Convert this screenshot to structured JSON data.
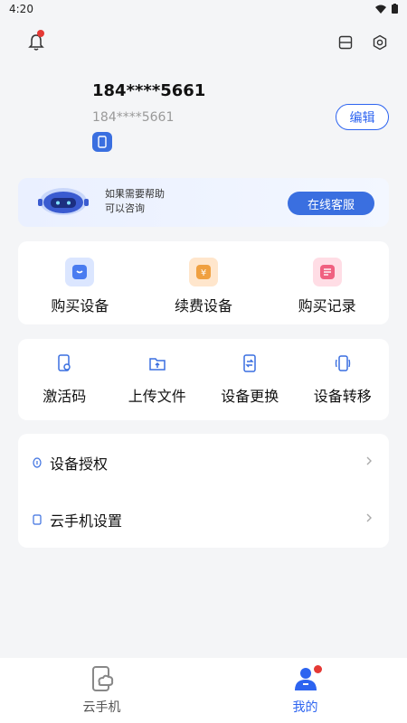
{
  "status": {
    "time": "4:20"
  },
  "header": {
    "bell_badge": "1"
  },
  "profile": {
    "username": "184****5661",
    "subname": "184****5661",
    "edit_label": "编辑"
  },
  "banner": {
    "line1": "如果需要帮助",
    "line2": "可以咨询",
    "button_label": "在线客服"
  },
  "card1": {
    "items": [
      {
        "label": "购买设备",
        "icon": "buy-device-icon",
        "color": "#4a7cf0"
      },
      {
        "label": "续费设备",
        "icon": "renew-icon",
        "color": "#f0a040"
      },
      {
        "label": "购买记录",
        "icon": "record-icon",
        "color": "#f06080"
      }
    ]
  },
  "card2": {
    "items": [
      {
        "label": "激活码",
        "icon": "activation-code-icon"
      },
      {
        "label": "上传文件",
        "icon": "upload-file-icon"
      },
      {
        "label": "设备更换",
        "icon": "device-swap-icon"
      },
      {
        "label": "设备转移",
        "icon": "device-transfer-icon"
      }
    ]
  },
  "menu": {
    "items": [
      {
        "label": "设备授权",
        "icon": "authorize-icon"
      },
      {
        "label": "云手机设置",
        "icon": "phone-settings-icon"
      }
    ]
  },
  "tabbar": {
    "tabs": [
      {
        "label": "云手机",
        "active": false
      },
      {
        "label": "我的",
        "active": true
      }
    ]
  },
  "colors": {
    "accent": "#2d64f0",
    "badge": "#e53935"
  }
}
